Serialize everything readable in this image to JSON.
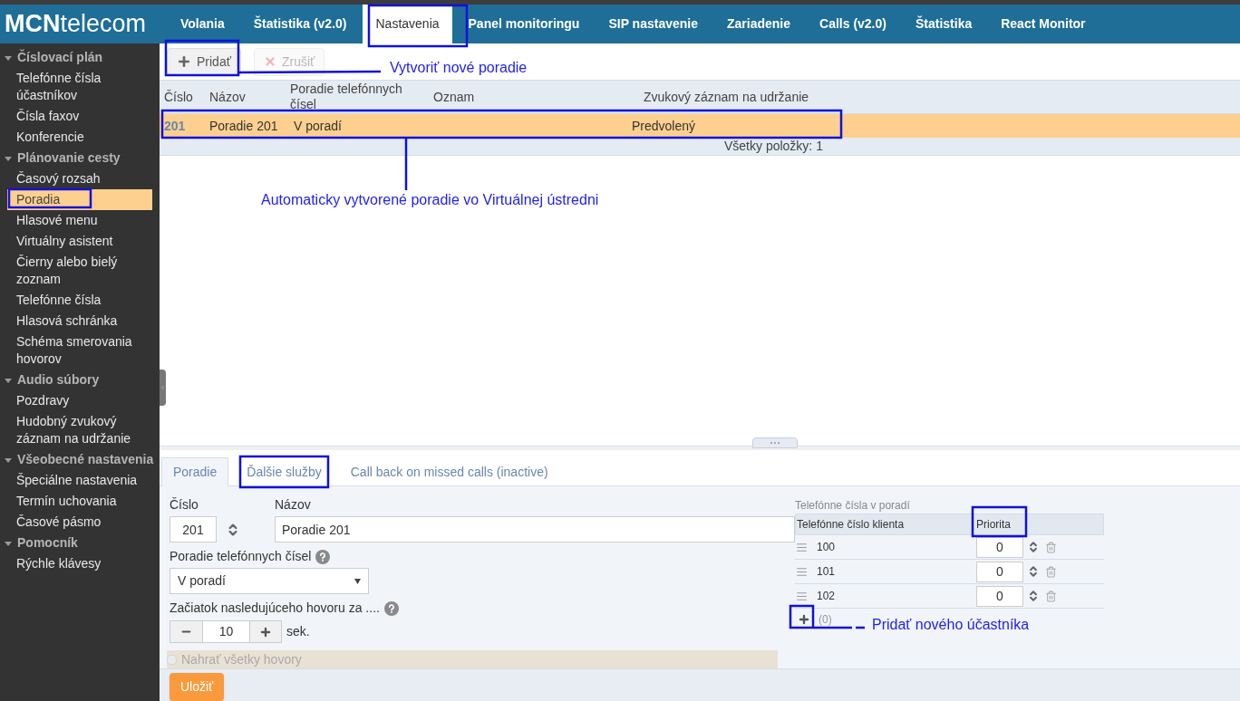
{
  "logo": {
    "bold": "MCN",
    "light": "telecom"
  },
  "nav_tabs": [
    {
      "label": "Volania",
      "selected": false
    },
    {
      "label": "Štatistika (v2.0)",
      "selected": false
    },
    {
      "label": "Nastavenia",
      "selected": true
    },
    {
      "label": "Panel monitoringu",
      "selected": false
    },
    {
      "label": "SIP nastavenie",
      "selected": false
    },
    {
      "label": "Zariadenie",
      "selected": false
    },
    {
      "label": "Calls (v2.0)",
      "selected": false
    },
    {
      "label": "Štatistika",
      "selected": false
    },
    {
      "label": "React Monitor",
      "selected": false
    }
  ],
  "sidebar": {
    "groups": [
      {
        "title": "Číslovací plán",
        "expanded": true,
        "items": [
          {
            "label": "Telefónne čísla účastníkov",
            "selected": false
          },
          {
            "label": "Čísla faxov",
            "selected": false
          },
          {
            "label": "Konferencie",
            "selected": false
          }
        ]
      },
      {
        "title": "Plánovanie cesty",
        "expanded": true,
        "items": [
          {
            "label": "Časový rozsah",
            "selected": false
          },
          {
            "label": "Poradia",
            "selected": true
          },
          {
            "label": "Hlasové menu",
            "selected": false
          },
          {
            "label": "Virtuálny asistent",
            "selected": false
          },
          {
            "label": "Čierny alebo bielý zoznam",
            "selected": false
          },
          {
            "label": "Telefónne čísla",
            "selected": false
          },
          {
            "label": "Hlasová schránka",
            "selected": false
          },
          {
            "label": "Schéma smerovania hovorov",
            "selected": false
          }
        ]
      },
      {
        "title": "Audio súbory",
        "expanded": true,
        "items": [
          {
            "label": "Pozdravy",
            "selected": false
          },
          {
            "label": "Hudobný zvukový záznam na udržanie",
            "selected": false
          }
        ]
      },
      {
        "title": "Všeobecné nastavenia",
        "expanded": true,
        "items": [
          {
            "label": "Špeciálne nastavenia",
            "selected": false
          },
          {
            "label": "Termín uchovania",
            "selected": false
          },
          {
            "label": "Časové pásmo",
            "selected": false
          }
        ]
      },
      {
        "title": "Pomocník",
        "expanded": true,
        "items": [
          {
            "label": "Rýchle klávesy",
            "selected": false
          }
        ]
      }
    ]
  },
  "toolbar": {
    "buttons": [
      {
        "label": "Pridať",
        "kind": "add",
        "disabled": false
      },
      {
        "label": "Zrušiť",
        "kind": "delete",
        "disabled": true
      }
    ]
  },
  "table": {
    "columns": [
      "Číslo",
      "Názov",
      "Poradie telefónnych čísel",
      "Oznam",
      "Zvukový záznam na udržanie"
    ],
    "rows": [
      {
        "number": "201",
        "name": "Poradie 201",
        "order": "V poradí",
        "hold_music": "Predvolený",
        "selected": true
      }
    ],
    "footer": "Všetky položky: 1"
  },
  "detail": {
    "tabs": [
      {
        "label": "Poradie",
        "selected": true
      },
      {
        "label": "Ďalšie služby",
        "selected": false
      },
      {
        "label": "Call back on missed calls (inactive)",
        "selected": false
      }
    ],
    "number_label": "Číslo",
    "number_value": "201",
    "name_label": "Názov",
    "name_value": "Poradie 201",
    "order_label": "Poradie telefónnych čísel",
    "order_value": "V poradí",
    "delay_label": "Začiatok nasledujúceho hovoru za ....",
    "delay_value": "10",
    "delay_unit": "sek.",
    "record": {
      "label": "Nahrať všetky hovory",
      "checked": false,
      "disabled": true
    },
    "members": {
      "title": "Telefónne čísla v poradí",
      "columns": [
        "Telefónne číslo klienta",
        "Priorita"
      ],
      "rows": [
        {
          "number": "100",
          "priority": "0"
        },
        {
          "number": "101",
          "priority": "0"
        },
        {
          "number": "102",
          "priority": "0"
        }
      ],
      "count": "(0)"
    },
    "save_button": "Uložiť"
  },
  "annotations": [
    "Vytvoriť nové poradie",
    "Automaticky vytvorené poradie vo Virtuálnej ústredni",
    "Pridať nového účastníka"
  ]
}
